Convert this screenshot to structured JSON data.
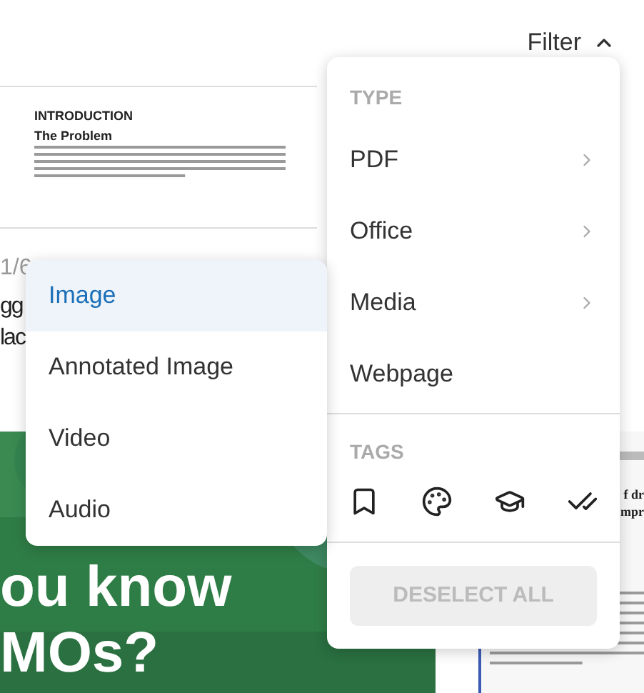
{
  "header": {
    "filter_label": "Filter",
    "expanded": true
  },
  "background": {
    "document": {
      "heading": "INTRODUCTION",
      "subheading": "The Problem"
    },
    "card": {
      "page_count": "1/6",
      "title_lines": [
        "gg",
        "lac"
      ]
    },
    "image_card": {
      "kind": "picture",
      "lines": [
        "ou know",
        "MOs?"
      ]
    },
    "right_document": {
      "title_lines": [
        "f dr",
        "mpr"
      ]
    }
  },
  "type_menu": {
    "section_title": "TYPE",
    "items": [
      {
        "label": "PDF",
        "has_submenu": true
      },
      {
        "label": "Office",
        "has_submenu": true
      },
      {
        "label": "Media",
        "has_submenu": true
      },
      {
        "label": "Webpage",
        "has_submenu": false
      }
    ],
    "tags_title": "TAGS",
    "tags": [
      {
        "kind": "bookmark"
      },
      {
        "kind": "palette"
      },
      {
        "kind": "graduation"
      },
      {
        "kind": "done-all"
      }
    ],
    "deselect_button": {
      "label": "DESELECT ALL",
      "disabled": true
    }
  },
  "submenu": {
    "items": [
      {
        "label": "Image",
        "selected": true
      },
      {
        "label": "Annotated Image",
        "selected": false
      },
      {
        "label": "Video",
        "selected": false
      },
      {
        "label": "Audio",
        "selected": false
      }
    ]
  }
}
